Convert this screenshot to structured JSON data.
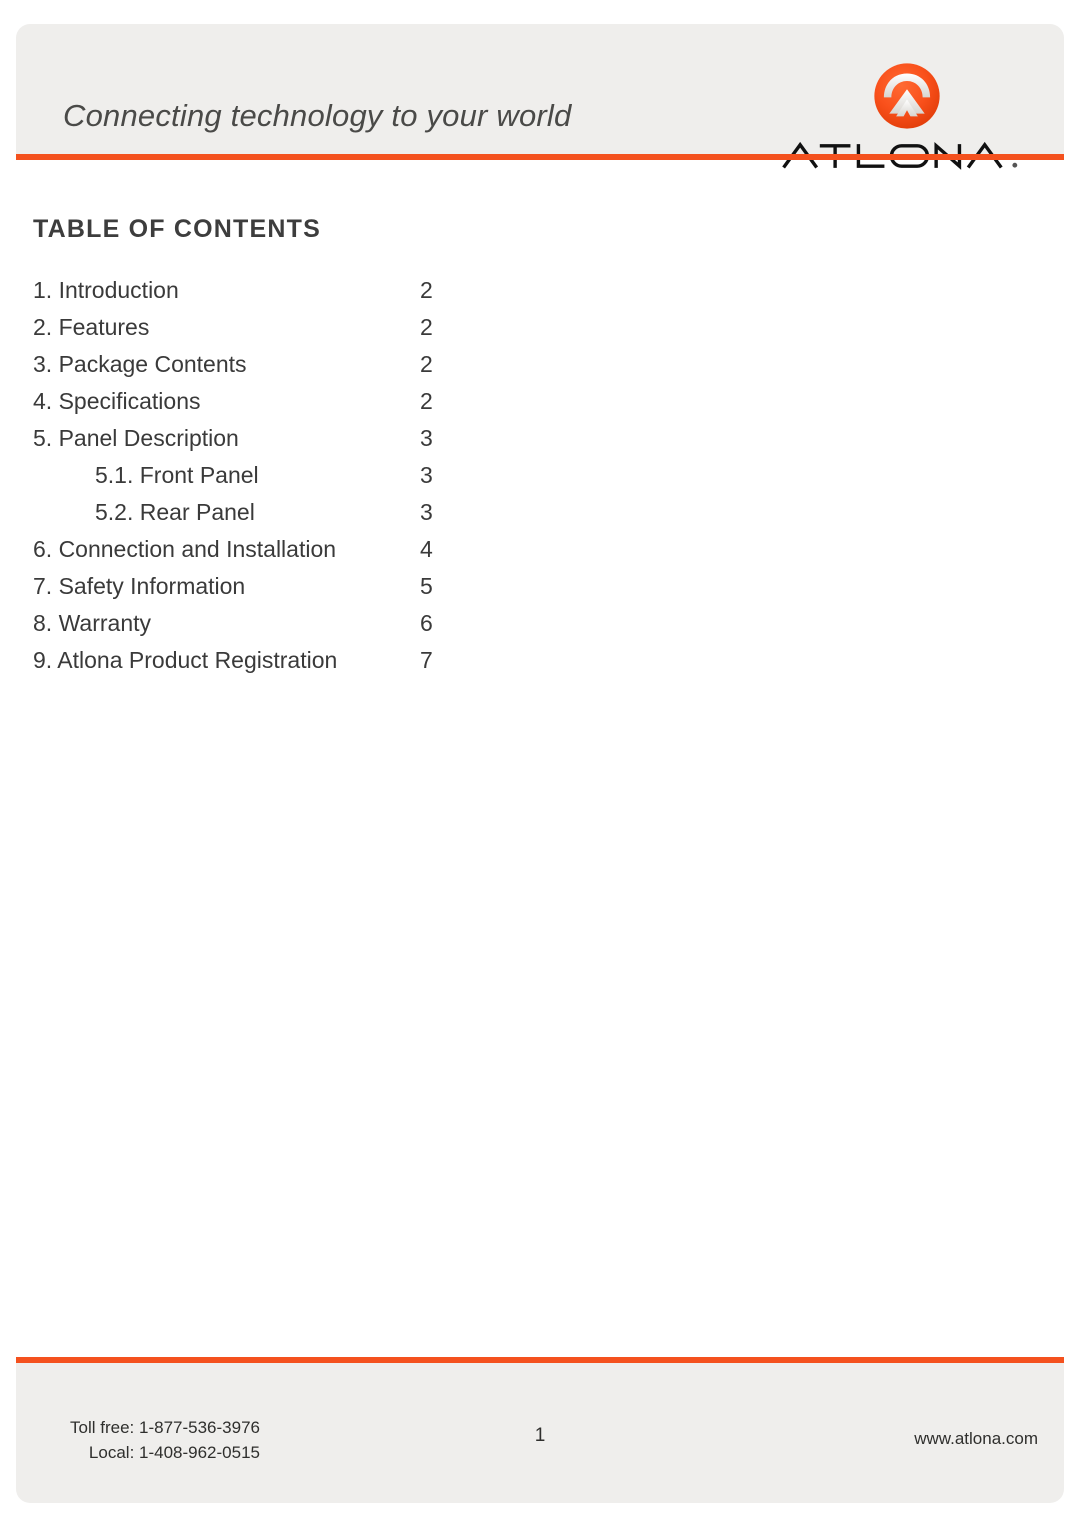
{
  "header": {
    "tagline": "Connecting technology to your world",
    "brand": "ATLONA",
    "brand_mark": "atlona-logo-icon",
    "accent_color": "#f4511e",
    "band_color": "#efeeec"
  },
  "main": {
    "toc_title": "TABLE OF CONTENTS",
    "entries": [
      {
        "label": "1. Introduction",
        "page": "2",
        "level": 1
      },
      {
        "label": "2. Features",
        "page": "2",
        "level": 1
      },
      {
        "label": "3. Package Contents",
        "page": "2",
        "level": 1
      },
      {
        "label": "4. Specifications",
        "page": "2",
        "level": 1
      },
      {
        "label": "5. Panel Description",
        "page": "3",
        "level": 1
      },
      {
        "label": "5.1. Front Panel",
        "page": "3",
        "level": 2
      },
      {
        "label": "5.2. Rear Panel",
        "page": "3",
        "level": 2
      },
      {
        "label": "6. Connection and Installation",
        "page": "4",
        "level": 1
      },
      {
        "label": "7. Safety Information",
        "page": "5",
        "level": 1
      },
      {
        "label": "8. Warranty",
        "page": "6",
        "level": 1
      },
      {
        "label": "9. Atlona Product Registration",
        "page": "7",
        "level": 1
      }
    ]
  },
  "footer": {
    "toll_free": "Toll free: 1-877-536-3976",
    "local": "Local: 1-408-962-0515",
    "page_number": "1",
    "website": "www.atlona.com"
  }
}
